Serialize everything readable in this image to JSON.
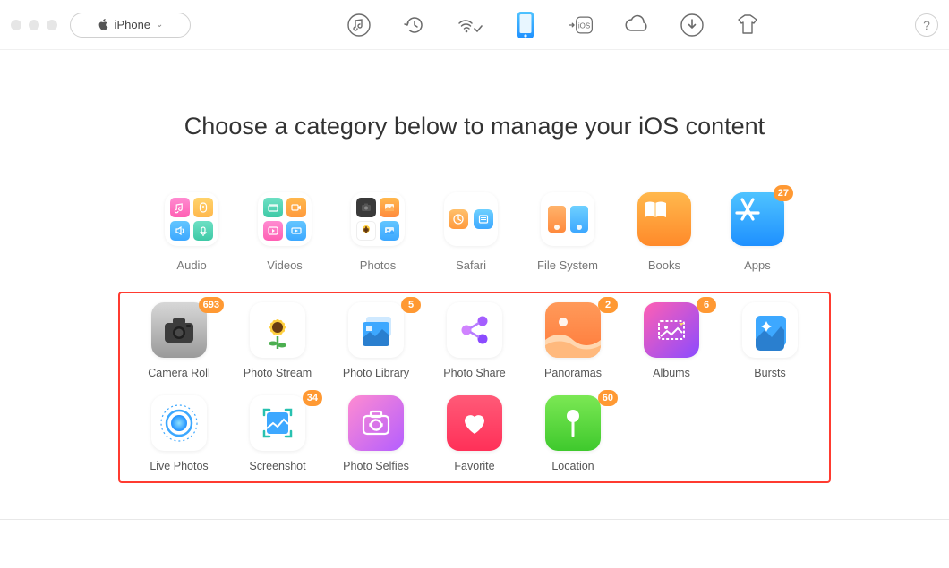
{
  "device_selector": {
    "label": "iPhone"
  },
  "toolbar": {
    "music": "music-icon",
    "restore": "restore-icon",
    "wifi_transfer": "wifi-transfer-icon",
    "phone": "phone-icon",
    "to_ios": "to-ios-icon",
    "icloud": "icloud-icon",
    "download": "download-icon",
    "skin": "skin-icon"
  },
  "help": {
    "glyph": "?"
  },
  "heading": "Choose a category below to manage your iOS content",
  "categories": [
    {
      "key": "audio",
      "label": "Audio"
    },
    {
      "key": "videos",
      "label": "Videos"
    },
    {
      "key": "photos",
      "label": "Photos"
    },
    {
      "key": "safari",
      "label": "Safari"
    },
    {
      "key": "filesystem",
      "label": "File System"
    },
    {
      "key": "books",
      "label": "Books"
    },
    {
      "key": "apps",
      "label": "Apps",
      "badge": "27"
    }
  ],
  "subcategories": [
    {
      "key": "cameraroll",
      "label": "Camera Roll",
      "badge": "693"
    },
    {
      "key": "photostream",
      "label": "Photo Stream"
    },
    {
      "key": "photolibrary",
      "label": "Photo Library",
      "badge": "5"
    },
    {
      "key": "photoshare",
      "label": "Photo Share"
    },
    {
      "key": "panoramas",
      "label": "Panoramas",
      "badge": "2"
    },
    {
      "key": "albums",
      "label": "Albums",
      "badge": "6"
    },
    {
      "key": "bursts",
      "label": "Bursts"
    },
    {
      "key": "livephotos",
      "label": "Live Photos"
    },
    {
      "key": "screenshot",
      "label": "Screenshot",
      "badge": "34"
    },
    {
      "key": "photoselfies",
      "label": "Photo Selfies"
    },
    {
      "key": "favorite",
      "label": "Favorite"
    },
    {
      "key": "location",
      "label": "Location",
      "badge": "60"
    }
  ],
  "colors": {
    "accent_badge": "#ff9933",
    "panel_border": "#ff3b30"
  }
}
